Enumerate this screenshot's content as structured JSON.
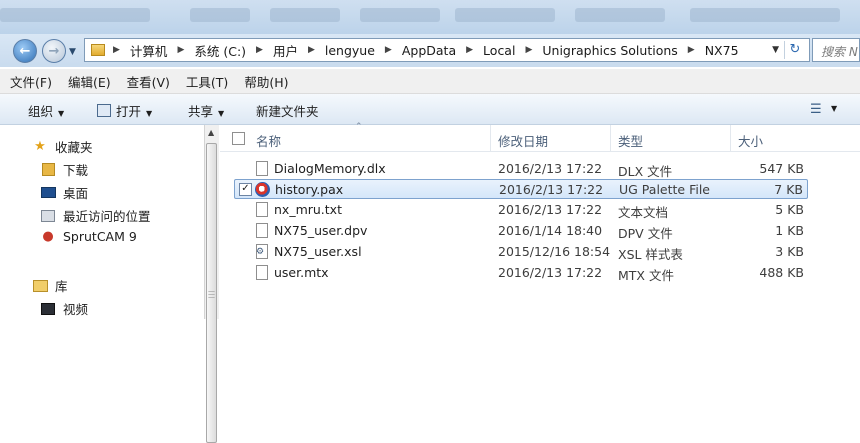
{
  "address": {
    "crumbs": [
      "计算机",
      "系统 (C:)",
      "用户",
      "lengyue",
      "AppData",
      "Local",
      "Unigraphics Solutions",
      "NX75"
    ],
    "search_placeholder": "搜索 N"
  },
  "menu": [
    "文件(F)",
    "编辑(E)",
    "查看(V)",
    "工具(T)",
    "帮助(H)"
  ],
  "commands": {
    "organize": "组织",
    "open": "打开",
    "share": "共享",
    "new_folder": "新建文件夹"
  },
  "nav": {
    "favorites": "收藏夹",
    "items": [
      "下载",
      "桌面",
      "最近访问的位置",
      "SprutCAM 9"
    ],
    "library": "库",
    "videos": "视频"
  },
  "columns": {
    "name": "名称",
    "date": "修改日期",
    "type": "类型",
    "size": "大小"
  },
  "files": [
    {
      "name": "DialogMemory.dlx",
      "date": "2016/2/13 17:22",
      "type": "DLX 文件",
      "size": "547 KB",
      "icon": "file-icon",
      "selected": false
    },
    {
      "name": "history.pax",
      "date": "2016/2/13 17:22",
      "type": "UG Palette File",
      "size": "7 KB",
      "icon": "pax-icon",
      "selected": true
    },
    {
      "name": "nx_mru.txt",
      "date": "2016/2/13 17:22",
      "type": "文本文档",
      "size": "5 KB",
      "icon": "file-icon",
      "selected": false
    },
    {
      "name": "NX75_user.dpv",
      "date": "2016/1/14 18:40",
      "type": "DPV 文件",
      "size": "1 KB",
      "icon": "file-icon",
      "selected": false
    },
    {
      "name": "NX75_user.xsl",
      "date": "2015/12/16 18:54",
      "type": "XSL 样式表",
      "size": "3 KB",
      "icon": "xsl-icon",
      "selected": false
    },
    {
      "name": "user.mtx",
      "date": "2016/2/13 17:22",
      "type": "MTX 文件",
      "size": "488 KB",
      "icon": "file-icon",
      "selected": false
    }
  ]
}
